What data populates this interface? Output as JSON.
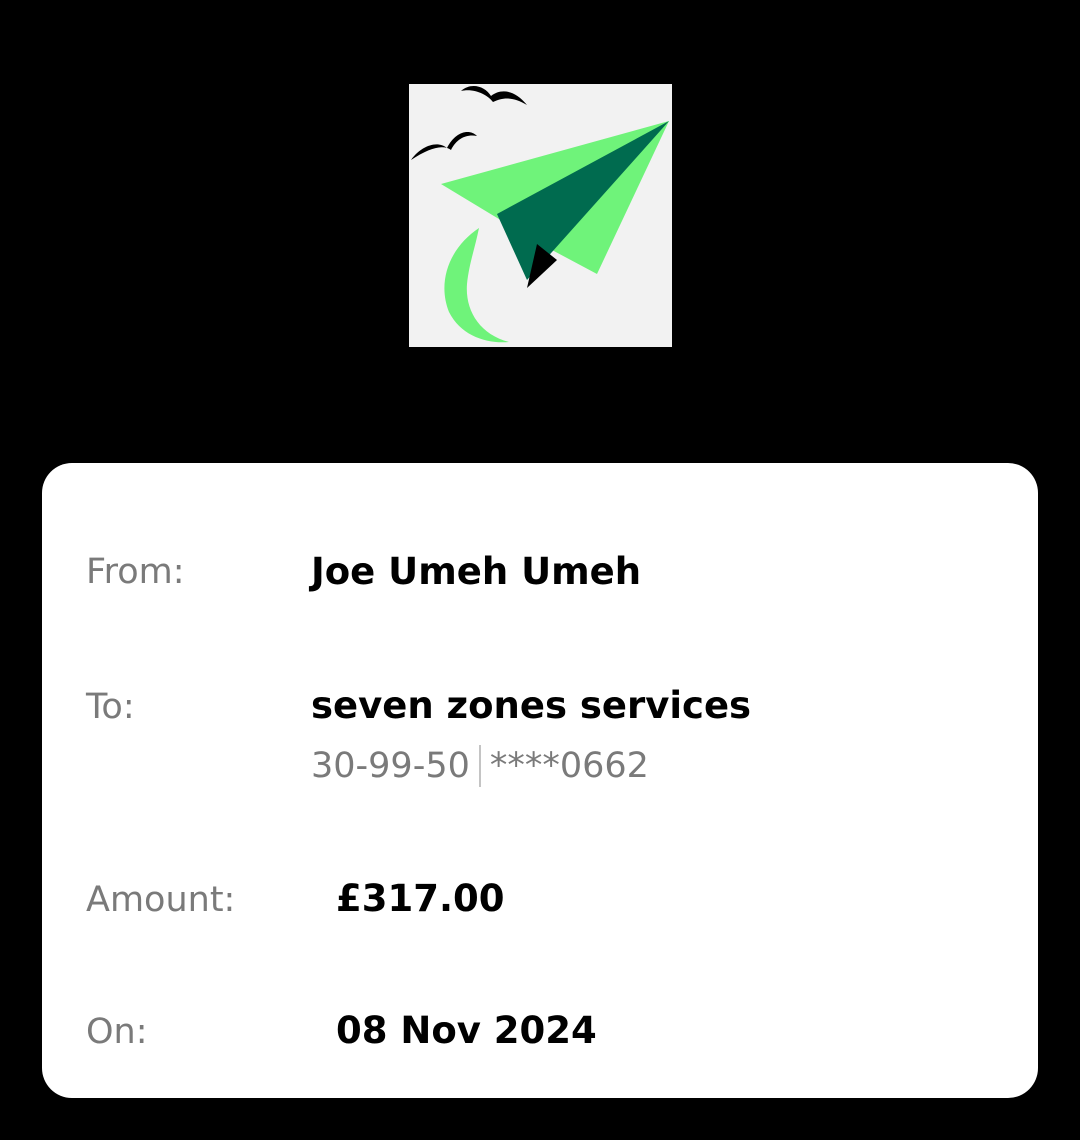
{
  "logo": {
    "icon": "paper-plane-logo",
    "colors": {
      "light_green": "#6ff37a",
      "dark_green": "#006b4f",
      "black": "#000000",
      "background": "#f2f2f2"
    }
  },
  "transfer": {
    "from_label": "From:",
    "from_value": "Joe Umeh Umeh",
    "to_label": "To:",
    "to_value": "seven zones services",
    "sort_code": "30-99-50",
    "account_masked": "****0662",
    "amount_label": "Amount:",
    "amount_value": "£317.00",
    "date_label": "On:",
    "date_value": "08 Nov 2024"
  }
}
